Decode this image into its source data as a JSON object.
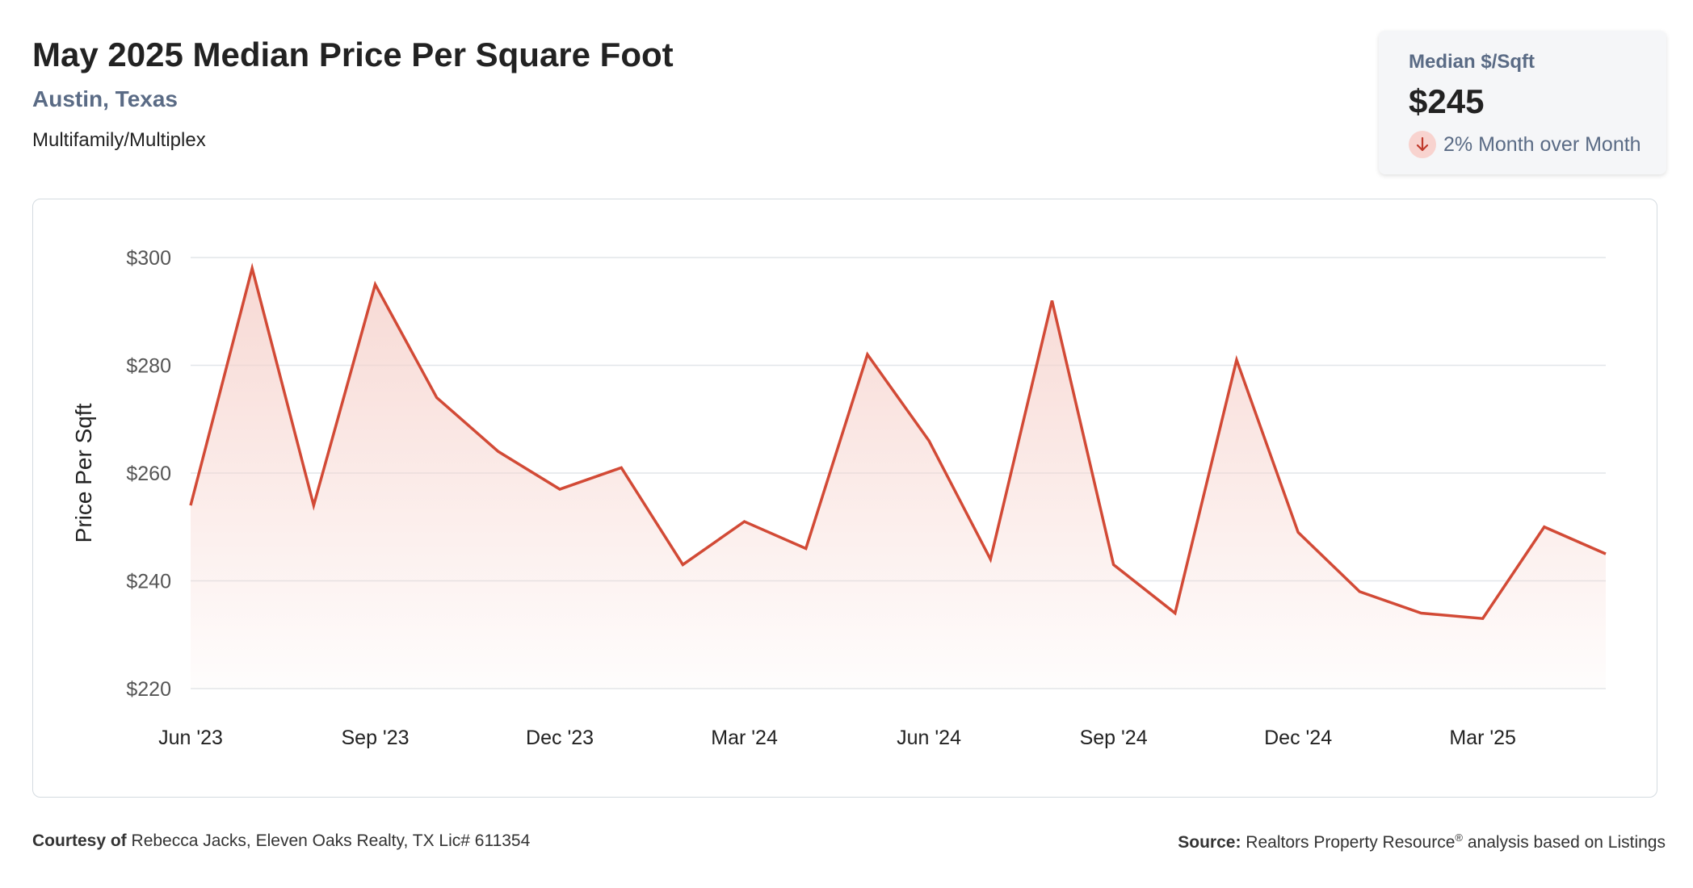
{
  "header": {
    "title": "May 2025 Median Price Per Square Foot",
    "location": "Austin, Texas",
    "category": "Multifamily/Multiplex"
  },
  "kpi": {
    "label": "Median $/Sqft",
    "value": "$245",
    "change_text": "2% Month over Month",
    "change_direction": "down",
    "change_icon": "arrow-down-icon"
  },
  "colors": {
    "line": "#d24a36",
    "fill": "#f6d2cc",
    "grid": "#e2e6e9",
    "subtitle": "#5a6b85"
  },
  "chart_data": {
    "type": "area",
    "title": "",
    "xlabel": "",
    "ylabel": "Price Per Sqft",
    "ylim": [
      220,
      300
    ],
    "yticks": [
      220,
      240,
      260,
      280,
      300
    ],
    "ytick_labels": [
      "$220",
      "$240",
      "$260",
      "$280",
      "$300"
    ],
    "x_tick_labels": [
      "Jun '23",
      "Sep '23",
      "Dec '23",
      "Mar '24",
      "Jun '24",
      "Sep '24",
      "Dec '24",
      "Mar '25"
    ],
    "x_tick_indices": [
      0,
      3,
      6,
      9,
      12,
      15,
      18,
      21
    ],
    "grid": true,
    "categories": [
      "Jun '23",
      "Jul '23",
      "Aug '23",
      "Sep '23",
      "Oct '23",
      "Nov '23",
      "Dec '23",
      "Jan '24",
      "Feb '24",
      "Mar '24",
      "Apr '24",
      "May '24",
      "Jun '24",
      "Jul '24",
      "Aug '24",
      "Sep '24",
      "Oct '24",
      "Nov '24",
      "Dec '24",
      "Jan '25",
      "Feb '25",
      "Mar '25",
      "Apr '25",
      "May '25"
    ],
    "series": [
      {
        "values": [
          254,
          298,
          254,
          295,
          274,
          264,
          257,
          261,
          243,
          251,
          246,
          282,
          266,
          244,
          292,
          243,
          234,
          281,
          249,
          238,
          234,
          233,
          250,
          245
        ]
      }
    ]
  },
  "footer": {
    "courtesy_label": "Courtesy of",
    "courtesy_text": "Rebecca Jacks, Eleven Oaks Realty, TX Lic# 611354",
    "source_label": "Source:",
    "source_text_a": "Realtors Property Resource",
    "source_reg": "®",
    "source_text_b": " analysis based on Listings"
  }
}
